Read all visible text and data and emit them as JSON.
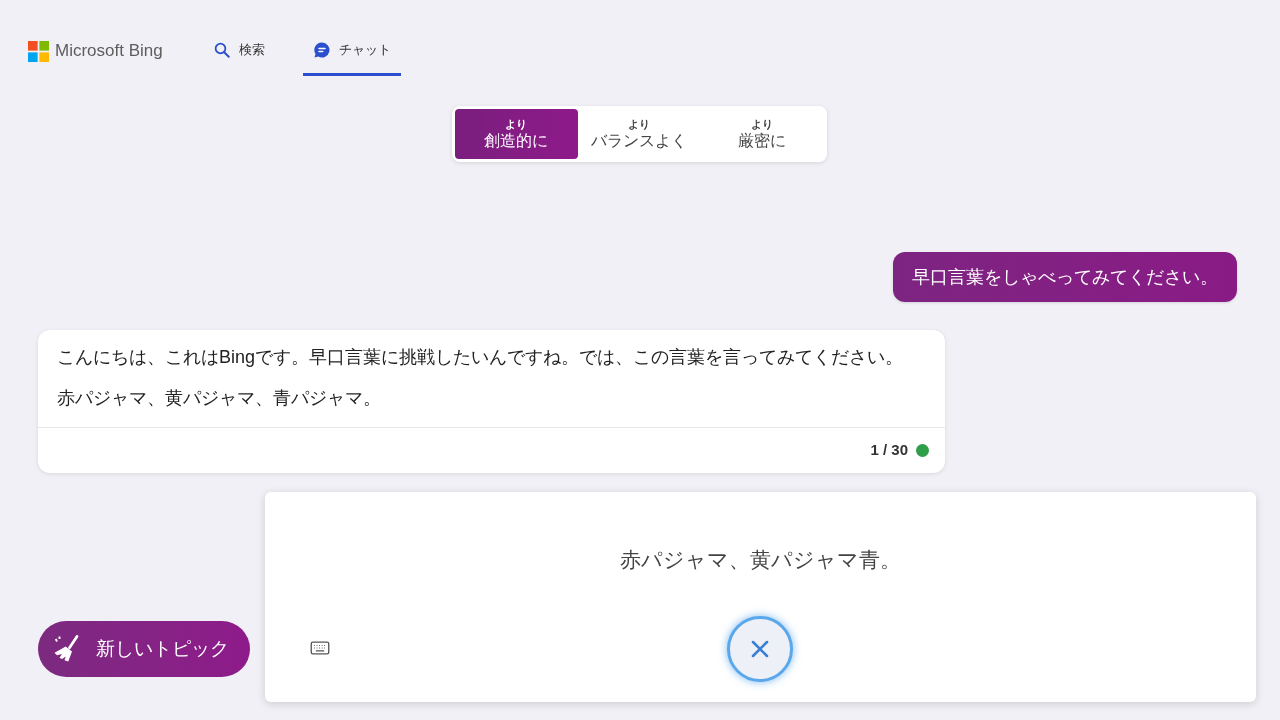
{
  "header": {
    "logo_text": "Microsoft Bing",
    "nav": [
      {
        "label": "検索",
        "kind": "search",
        "selected": false
      },
      {
        "label": "チャット",
        "kind": "chat",
        "selected": true
      }
    ]
  },
  "tones": [
    {
      "prefix": "より",
      "label": "創造的に",
      "selected": true
    },
    {
      "prefix": "より",
      "label": "バランスよく",
      "selected": false
    },
    {
      "prefix": "より",
      "label": "厳密に",
      "selected": false
    }
  ],
  "messages": [
    {
      "kind": "user",
      "paragraphs": [
        "早口言葉をしゃべってみてください。"
      ]
    },
    {
      "kind": "bot",
      "paragraphs": [
        "こんにちは、これはBingです。早口言葉に挑戦したいんですね。では、この言葉を言ってみてください。",
        "赤パジャマ、黄パジャマ、青パジャマ。"
      ],
      "counter": "1 / 30",
      "color": "#2e9e48"
    }
  ],
  "new_topic": "新しいトピック",
  "voice": {
    "transcript": "赤パジャマ、黄パジャマ青。"
  }
}
